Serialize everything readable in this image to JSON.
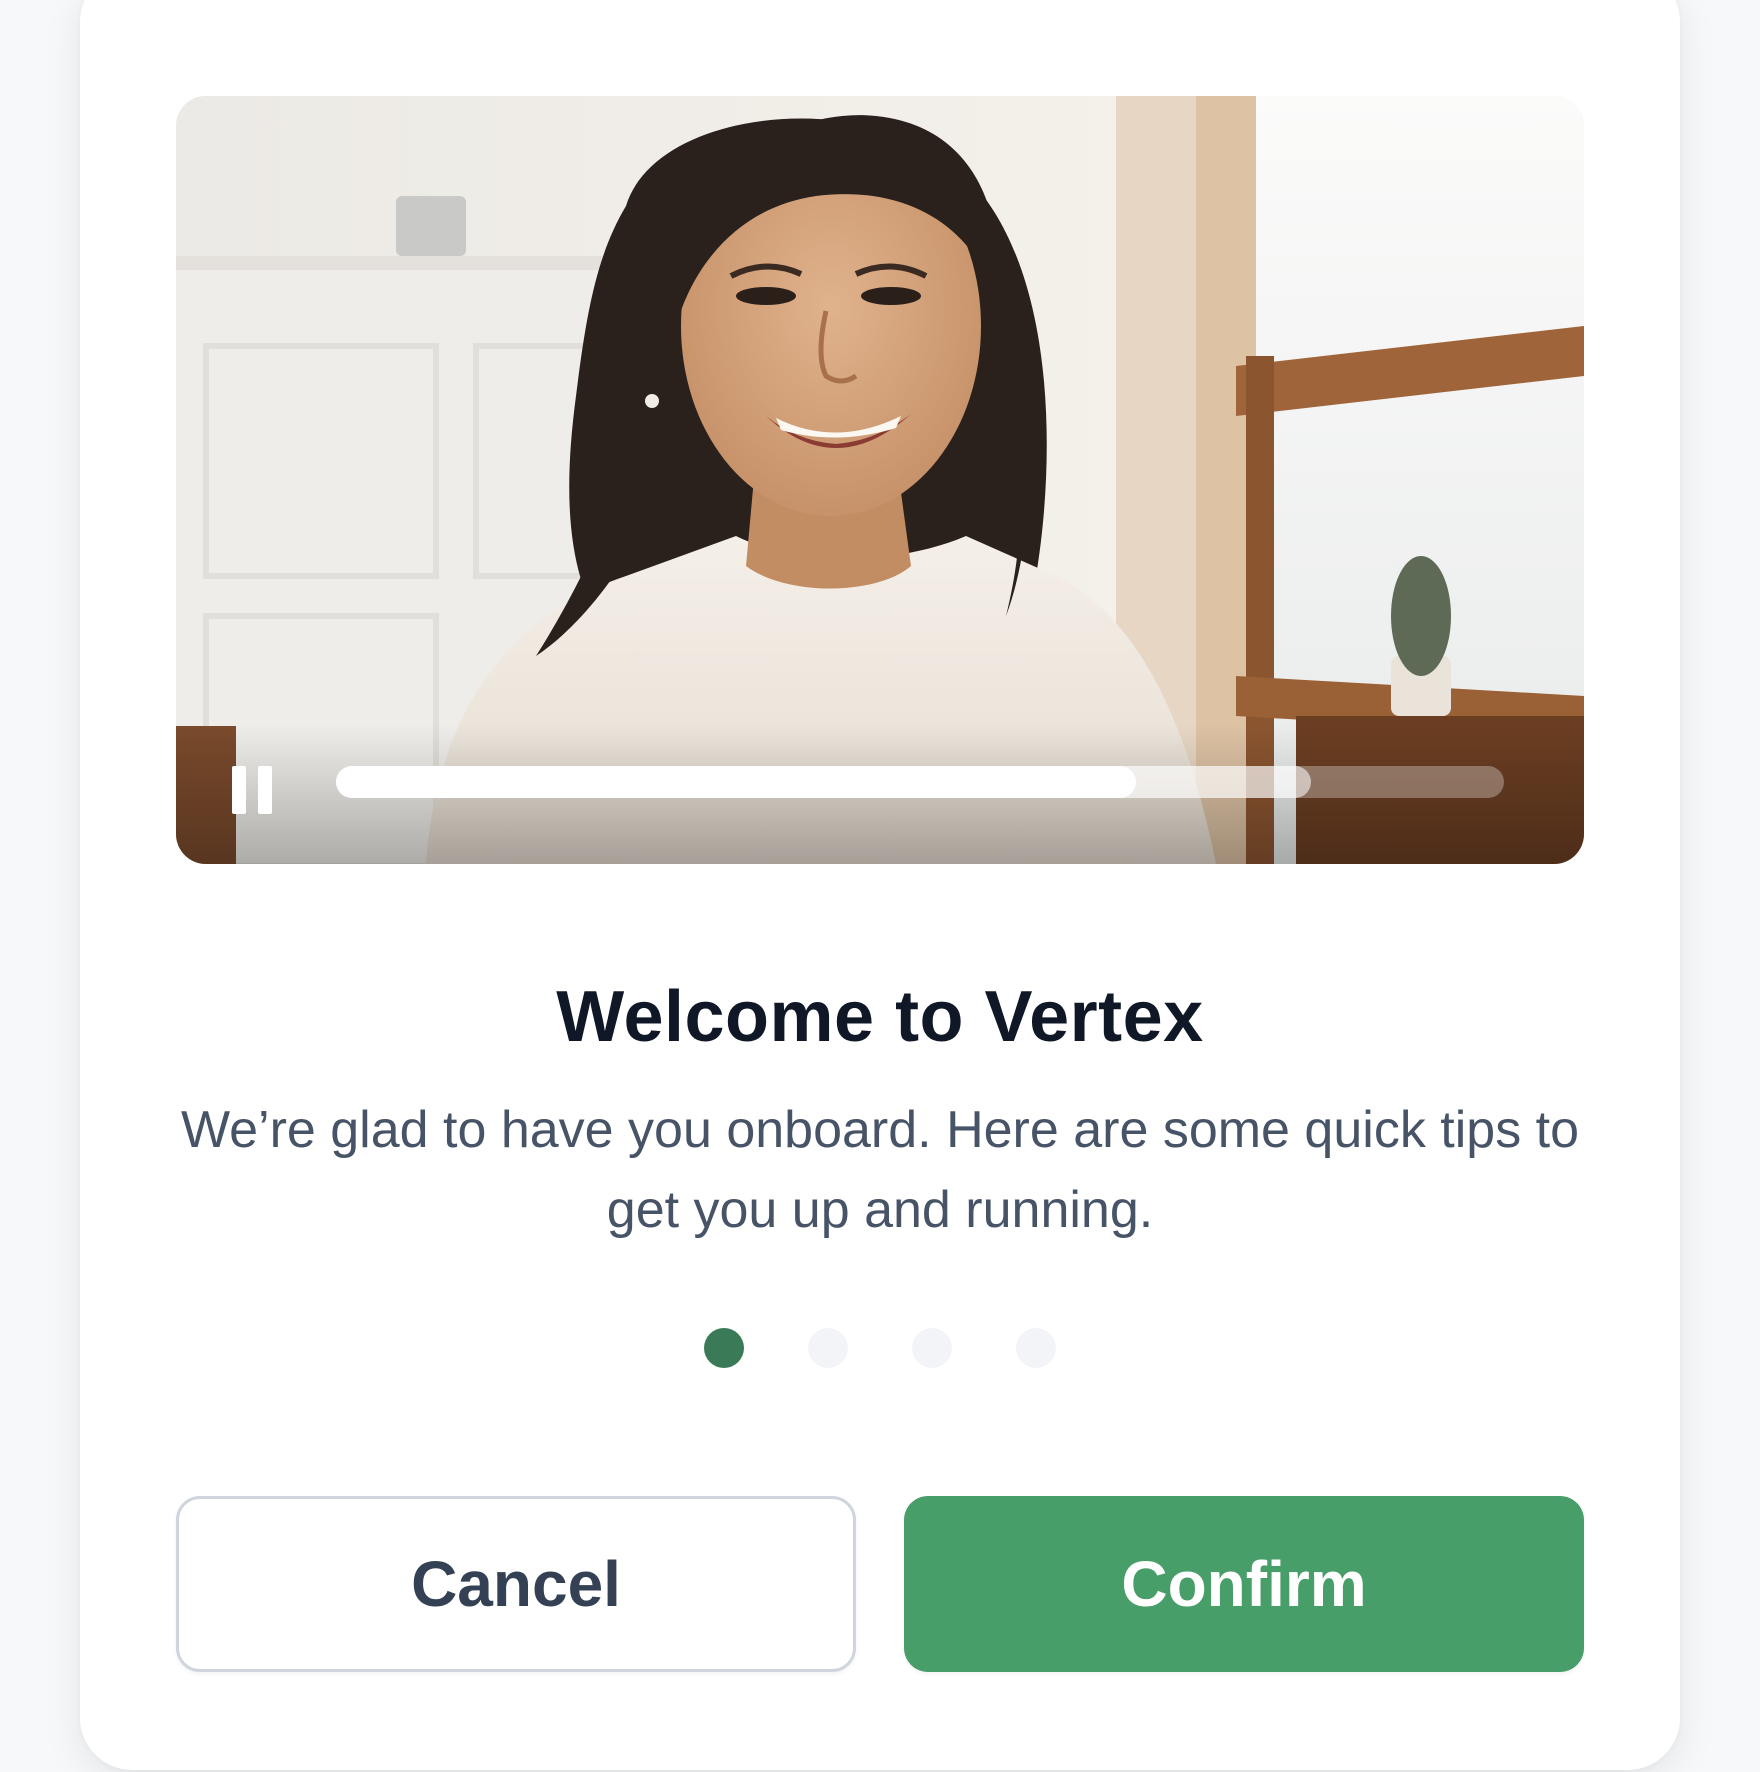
{
  "video": {
    "image_description": "Smiling woman with long dark hair wearing a white t-shirt in a bright room",
    "playback_state": "playing",
    "control_icon": "pause-icon",
    "progress_played": 0.685,
    "progress_buffered": 0.835
  },
  "content": {
    "title": "Welcome to Vertex",
    "subtitle": "We’re glad to have you onboard. Here are some quick tips to get you up and running."
  },
  "pagination": {
    "total": 4,
    "active_index": 0
  },
  "actions": {
    "cancel_label": "Cancel",
    "confirm_label": "Confirm"
  },
  "colors": {
    "accent": "#489e68",
    "active_dot": "#3b7a57",
    "inactive_dot": "#f2f4f7",
    "title": "#101828",
    "body_text": "#475467"
  }
}
